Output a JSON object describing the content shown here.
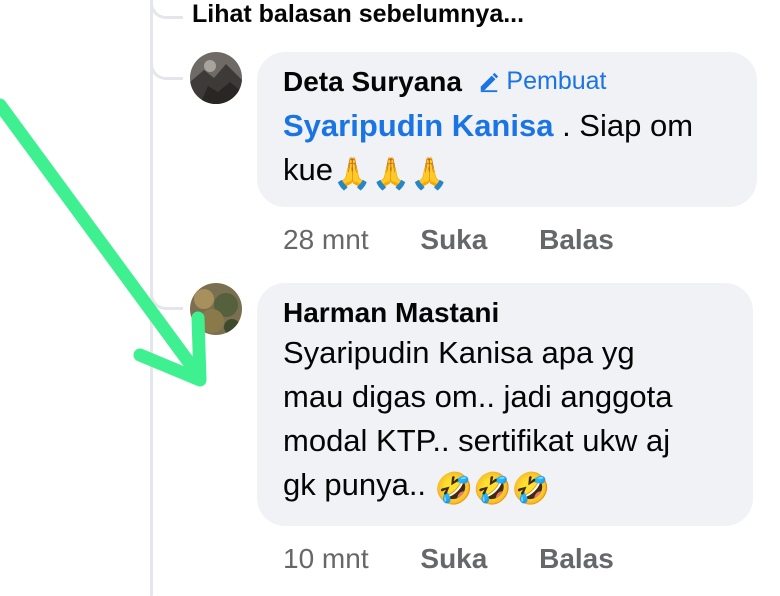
{
  "thread": {
    "view_previous_label": "Lihat balasan sebelumnya..."
  },
  "comments": [
    {
      "author": "Deta Suryana",
      "badge_label": "Pembuat",
      "mention": "Syaripudin Kanisa",
      "text_line1_rest": " . Siap om",
      "text_line2": "kue",
      "emoji": "🙏🙏🙏",
      "time": "28 mnt",
      "like_label": "Suka",
      "reply_label": "Balas"
    },
    {
      "author": "Harman Mastani",
      "text_line1": "Syaripudin Kanisa apa yg",
      "text_line2": "mau digas om.. jadi anggota",
      "text_line3": "modal KTP.. sertifikat ukw aj",
      "text_line4": "gk punya.. ",
      "emoji": "🤣🤣🤣",
      "time": "10 mnt",
      "like_label": "Suka",
      "reply_label": "Balas"
    }
  ],
  "colors": {
    "accent_blue": "#1b74e4",
    "bubble_bg": "#f0f2f5",
    "meta_gray": "#65676b",
    "annotation_arrow": "#3ef08f"
  },
  "icons": {
    "badge": "pencil-icon",
    "annotation": "arrow-annotation-icon"
  }
}
